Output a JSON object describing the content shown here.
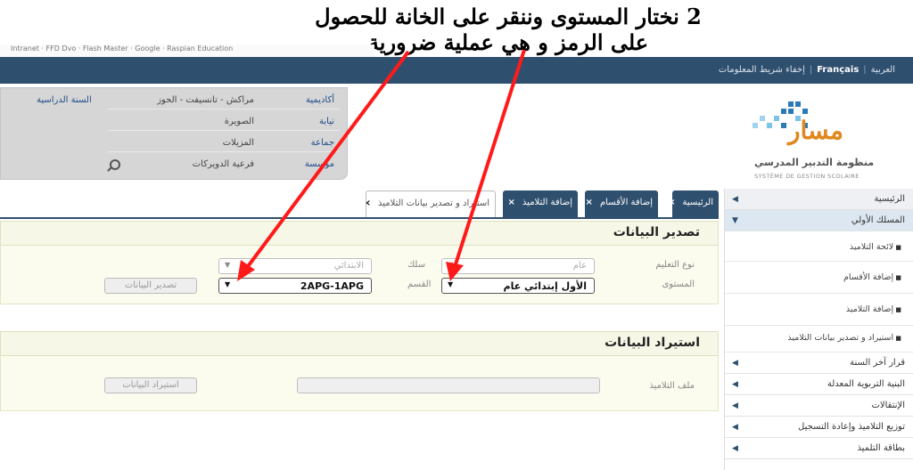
{
  "annotation": {
    "instruction": "2 نختار المستوى وننقر على الخانة للحصول على الرمز و هي عملية ضرورية",
    "color": "#ff1a1a"
  },
  "browser_strip": "Intranet  ·  FFD Dvo  ·  Flash Master  ·  Google  ·  Raspian Education",
  "topbar": {
    "lang_ar": "العربية",
    "lang_fr": "Français",
    "info_bar": "إخفاء شريط المعلومات"
  },
  "info": {
    "academy_label": "أكاديمية",
    "academy_value": "مراكش - تانسيفت - الحوز",
    "province_label": "نيابة",
    "province_value": "الصويرة",
    "commune_label": "جماعة",
    "commune_value": "المزيلات",
    "school_label": "مؤسسة",
    "school_value": "فرعية الدويركات",
    "year_label": "السنة الدراسية"
  },
  "logo": {
    "word": "مسار",
    "subtitle_ar": "منظومة التدبير المدرسي",
    "subtitle_fr": "SYSTÈME DE GESTION SCOLAIRE"
  },
  "tabs": [
    {
      "label": "الرئيسية",
      "close": "×"
    },
    {
      "label": "إضافة الأقسام",
      "close": "×"
    },
    {
      "label": "إضافة التلاميذ",
      "close": "×"
    },
    {
      "label": "استيراد و تصدير بيانات التلاميذ",
      "close": "×"
    }
  ],
  "sidebar": {
    "home": "الرئيسية",
    "level_path": "المسلك الأولي",
    "subitems": [
      "لائحة التلاميذ",
      "إضافة الأقسام",
      "إضافة التلاميذ",
      "استيراد و تصدير بيانات التلاميذ"
    ],
    "items": [
      "قرار آخر السنة",
      "البنية التربوية المعدلة",
      "الإنتقالات",
      "توزيع التلاميذ وإعادة التسجيل",
      "بطاقة التلميذ"
    ]
  },
  "export_section": {
    "title": "تصدير البيانات",
    "edu_type_label": "نوع التعليم",
    "edu_type_value": "عام",
    "cycle_label": "سلك",
    "cycle_value": "الابتدائي",
    "level_label": "المستوى",
    "level_value": "الأول إبتدائي عام",
    "class_label": "القسم",
    "class_value": "2APG-1APG",
    "button": "تصدير البيانات"
  },
  "import_section": {
    "title": "استيراد البيانات",
    "file_label": "ملف التلاميذ",
    "button": "استيراد البيانات"
  }
}
